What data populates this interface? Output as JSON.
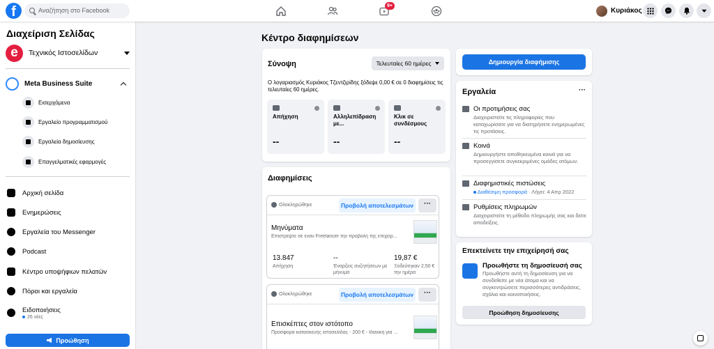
{
  "topbar": {
    "logo": "f",
    "search_placeholder": "Αναζήτηση στο Facebook",
    "nav_icons": [
      "home-icon",
      "friends-icon",
      "watch-icon",
      "groups-icon"
    ],
    "watch_badge": "9+",
    "profile_name": "Κυριάκος"
  },
  "sidebar": {
    "title": "Διαχείριση Σελίδας",
    "page_logo_letter": "e",
    "page_name": "Τεχνικός Ιστοσελίδων",
    "business_suite": "Meta Business Suite",
    "sub_items": [
      {
        "label": "Εισερχόμενα",
        "icon": "inbox-icon"
      },
      {
        "label": "Εργαλείο προγραμματισμού",
        "icon": "calendar-icon"
      },
      {
        "label": "Εργαλεία δημοσίευσης",
        "icon": "publishing-icon"
      },
      {
        "label": "Επαγγελματικές εφαρμογές",
        "icon": "apps-icon"
      }
    ],
    "nav_items": [
      {
        "label": "Αρχική σελίδα",
        "icon": "home-icon"
      },
      {
        "label": "Ενημερώσεις",
        "icon": "updates-icon"
      },
      {
        "label": "Εργαλεία του Messenger",
        "icon": "messenger-icon"
      },
      {
        "label": "Podcast",
        "icon": "podcast-icon"
      },
      {
        "label": "Κέντρο υποψήφιων πελατών",
        "icon": "leads-icon"
      },
      {
        "label": "Πόροι και εργαλεία",
        "icon": "info-icon"
      },
      {
        "label": "Ειδοποιήσεις",
        "icon": "bell-icon"
      }
    ],
    "notifications_sub": "26 νέες",
    "promote_label": "Προώθηση"
  },
  "main": {
    "title": "Κέντρο διαφημίσεων",
    "summary": {
      "title": "Σύνοψη",
      "range": "Τελευταίες 60 ημέρες",
      "text": "Ο λογαριασμός Κυριάκος Τζεντζιρίδης ξόδεψε 0,00 € σε 0 διαφημίσεις τις τελευταίες 60 ημέρες.",
      "stats": [
        {
          "label": "Απήχηση",
          "value": "--"
        },
        {
          "label": "Αλληλεπίδραση με...",
          "value": "--"
        },
        {
          "label": "Κλικ σε συνδέσμους",
          "value": "--"
        }
      ]
    },
    "ads": {
      "title": "Διαφημίσεις",
      "view_results": "Προβολή αποτελεσμάτων",
      "more": "···",
      "items": [
        {
          "status": "Ολοκληρώθηκε",
          "name": "Μηνύματα",
          "desc": "Επιστρέψτε σε έναν Freelancer την προβολή της επιχείρ...",
          "m1": "13.847",
          "m1_label": "Απήχηση",
          "m2": "--",
          "m2_label": "Έναρξεις συζητήσεων με μήνυμα",
          "m3": "19,87 €",
          "m3_label": "Ξοδεύτηκαν 2,50 € την ημέρα"
        },
        {
          "status": "Ολοκληρώθηκε",
          "name": "Επισκέπτες στον ιστότοπο",
          "desc": "Προσφορά κατασκευής ιστοσελίδας - 200 € - Ιδανική για ..."
        }
      ]
    }
  },
  "right": {
    "create_ad": "Δημιουργία διαφήμισης",
    "tools": {
      "title": "Εργαλεία",
      "more": "···",
      "items": [
        {
          "title": "Οι προτιμήσεις σας",
          "desc": "Διαχειριστείτε τις πληροφορίες που καταχωρίσατε για να διατηρήσετε ενημερωμένες τις προτάσεις.",
          "icon": "preferences-icon"
        },
        {
          "title": "Κοινά",
          "desc": "Δημιουργήστε αποθηκευμένα κοινά για να προσεγγίσετε συγκεκριμένες ομάδες ατόμων.",
          "icon": "audience-icon"
        },
        {
          "title": "Διαφημιστικές πιστώσεις",
          "link": "Διαθέσιμη προσφορά",
          "expiry": "· Λήγει: 4 Απρ 2022",
          "icon": "credits-icon"
        },
        {
          "title": "Ρυθμίσεις πληρωμών",
          "desc": "Διαχειριστείτε τη μέθοδο πληρωμής σας και δείτε αποδείξεις.",
          "icon": "payment-icon"
        }
      ]
    },
    "expand": {
      "title": "Επεκτείνετε την επιχείρησή σας",
      "item_title": "Προωθήστε τη δημοσίευσή σας",
      "item_desc": "Προωθήστε αυτή τη δημοσίευση για να συνδεθείτε με νέα άτομα και να συγκεντρώσετε περισσότερες αντιδράσεις, σχόλια και κοινοποιήσεις.",
      "button": "Προώθηση δημοσίευσης"
    }
  }
}
